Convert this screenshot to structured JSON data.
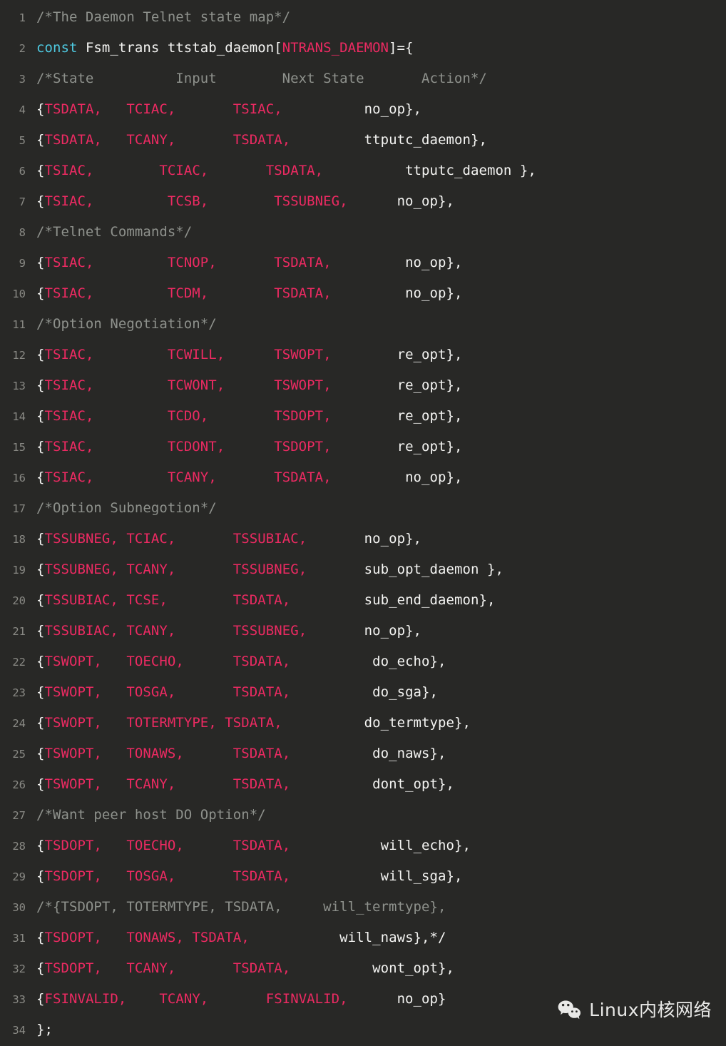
{
  "editor": {
    "background": "#282826",
    "line_number_color": "#8a8a85",
    "text_color": "#f2f2f2",
    "comment_color": "#8e918c",
    "constant_color": "#ec2a62",
    "keyword_color": "#4ec9e0",
    "language": "C",
    "first_line": 1,
    "last_line": 34
  },
  "watermark": {
    "logo": "wechat-icon",
    "label": "Linux内核网络"
  },
  "code": {
    "lines": [
      {
        "n": "1",
        "tokens": [
          {
            "t": "/*The Daemon Telnet state map*/",
            "c": "comment"
          }
        ]
      },
      {
        "n": "2",
        "tokens": [
          {
            "t": "const",
            "c": "kw"
          },
          {
            "t": " Fsm_trans ttstab_daemon[",
            "c": "plain"
          },
          {
            "t": "NTRANS_DAEMON",
            "c": "const"
          },
          {
            "t": "]={",
            "c": "plain"
          }
        ]
      },
      {
        "n": "3",
        "tokens": [
          {
            "t": "/*State          Input        Next State       Action*/",
            "c": "comment"
          }
        ]
      },
      {
        "n": "4",
        "tokens": [
          {
            "t": "{",
            "c": "plain"
          },
          {
            "t": "TSDATA,",
            "c": "const"
          },
          {
            "t": "   ",
            "c": "plain"
          },
          {
            "t": "TCIAC,",
            "c": "const"
          },
          {
            "t": "       ",
            "c": "plain"
          },
          {
            "t": "TSIAC,",
            "c": "const"
          },
          {
            "t": "          ",
            "c": "plain"
          },
          {
            "t": "no_op},",
            "c": "plain"
          }
        ]
      },
      {
        "n": "5",
        "tokens": [
          {
            "t": "{",
            "c": "plain"
          },
          {
            "t": "TSDATA,",
            "c": "const"
          },
          {
            "t": "   ",
            "c": "plain"
          },
          {
            "t": "TCANY,",
            "c": "const"
          },
          {
            "t": "       ",
            "c": "plain"
          },
          {
            "t": "TSDATA,",
            "c": "const"
          },
          {
            "t": "         ",
            "c": "plain"
          },
          {
            "t": "ttputc_daemon},",
            "c": "plain"
          }
        ]
      },
      {
        "n": "6",
        "tokens": [
          {
            "t": "{",
            "c": "plain"
          },
          {
            "t": "TSIAC,",
            "c": "const"
          },
          {
            "t": "        ",
            "c": "plain"
          },
          {
            "t": "TCIAC,",
            "c": "const"
          },
          {
            "t": "       ",
            "c": "plain"
          },
          {
            "t": "TSDATA,",
            "c": "const"
          },
          {
            "t": "          ",
            "c": "plain"
          },
          {
            "t": "ttputc_daemon },",
            "c": "plain"
          }
        ]
      },
      {
        "n": "7",
        "tokens": [
          {
            "t": "{",
            "c": "plain"
          },
          {
            "t": "TSIAC,",
            "c": "const"
          },
          {
            "t": "         ",
            "c": "plain"
          },
          {
            "t": "TCSB,",
            "c": "const"
          },
          {
            "t": "        ",
            "c": "plain"
          },
          {
            "t": "TSSUBNEG,",
            "c": "const"
          },
          {
            "t": "      ",
            "c": "plain"
          },
          {
            "t": "no_op},",
            "c": "plain"
          }
        ]
      },
      {
        "n": "8",
        "tokens": [
          {
            "t": "/*Telnet Commands*/",
            "c": "comment"
          }
        ]
      },
      {
        "n": "9",
        "tokens": [
          {
            "t": "{",
            "c": "plain"
          },
          {
            "t": "TSIAC,",
            "c": "const"
          },
          {
            "t": "         ",
            "c": "plain"
          },
          {
            "t": "TCNOP,",
            "c": "const"
          },
          {
            "t": "       ",
            "c": "plain"
          },
          {
            "t": "TSDATA,",
            "c": "const"
          },
          {
            "t": "         ",
            "c": "plain"
          },
          {
            "t": "no_op},",
            "c": "plain"
          }
        ]
      },
      {
        "n": "10",
        "tokens": [
          {
            "t": "{",
            "c": "plain"
          },
          {
            "t": "TSIAC,",
            "c": "const"
          },
          {
            "t": "         ",
            "c": "plain"
          },
          {
            "t": "TCDM,",
            "c": "const"
          },
          {
            "t": "        ",
            "c": "plain"
          },
          {
            "t": "TSDATA,",
            "c": "const"
          },
          {
            "t": "         ",
            "c": "plain"
          },
          {
            "t": "no_op},",
            "c": "plain"
          }
        ]
      },
      {
        "n": "11",
        "tokens": [
          {
            "t": "/*Option Negotiation*/",
            "c": "comment"
          }
        ]
      },
      {
        "n": "12",
        "tokens": [
          {
            "t": "{",
            "c": "plain"
          },
          {
            "t": "TSIAC,",
            "c": "const"
          },
          {
            "t": "         ",
            "c": "plain"
          },
          {
            "t": "TCWILL,",
            "c": "const"
          },
          {
            "t": "      ",
            "c": "plain"
          },
          {
            "t": "TSWOPT,",
            "c": "const"
          },
          {
            "t": "        ",
            "c": "plain"
          },
          {
            "t": "re_opt},",
            "c": "plain"
          }
        ]
      },
      {
        "n": "13",
        "tokens": [
          {
            "t": "{",
            "c": "plain"
          },
          {
            "t": "TSIAC,",
            "c": "const"
          },
          {
            "t": "         ",
            "c": "plain"
          },
          {
            "t": "TCWONT,",
            "c": "const"
          },
          {
            "t": "      ",
            "c": "plain"
          },
          {
            "t": "TSWOPT,",
            "c": "const"
          },
          {
            "t": "        ",
            "c": "plain"
          },
          {
            "t": "re_opt},",
            "c": "plain"
          }
        ]
      },
      {
        "n": "14",
        "tokens": [
          {
            "t": "{",
            "c": "plain"
          },
          {
            "t": "TSIAC,",
            "c": "const"
          },
          {
            "t": "         ",
            "c": "plain"
          },
          {
            "t": "TCDO,",
            "c": "const"
          },
          {
            "t": "        ",
            "c": "plain"
          },
          {
            "t": "TSDOPT,",
            "c": "const"
          },
          {
            "t": "        ",
            "c": "plain"
          },
          {
            "t": "re_opt},",
            "c": "plain"
          }
        ]
      },
      {
        "n": "15",
        "tokens": [
          {
            "t": "{",
            "c": "plain"
          },
          {
            "t": "TSIAC,",
            "c": "const"
          },
          {
            "t": "         ",
            "c": "plain"
          },
          {
            "t": "TCDONT,",
            "c": "const"
          },
          {
            "t": "      ",
            "c": "plain"
          },
          {
            "t": "TSDOPT,",
            "c": "const"
          },
          {
            "t": "        ",
            "c": "plain"
          },
          {
            "t": "re_opt},",
            "c": "plain"
          }
        ]
      },
      {
        "n": "16",
        "tokens": [
          {
            "t": "{",
            "c": "plain"
          },
          {
            "t": "TSIAC,",
            "c": "const"
          },
          {
            "t": "         ",
            "c": "plain"
          },
          {
            "t": "TCANY,",
            "c": "const"
          },
          {
            "t": "       ",
            "c": "plain"
          },
          {
            "t": "TSDATA,",
            "c": "const"
          },
          {
            "t": "         ",
            "c": "plain"
          },
          {
            "t": "no_op},",
            "c": "plain"
          }
        ]
      },
      {
        "n": "17",
        "tokens": [
          {
            "t": "/*Option Subnegotion*/",
            "c": "comment"
          }
        ]
      },
      {
        "n": "18",
        "tokens": [
          {
            "t": "{",
            "c": "plain"
          },
          {
            "t": "TSSUBNEG,",
            "c": "const"
          },
          {
            "t": " ",
            "c": "plain"
          },
          {
            "t": "TCIAC,",
            "c": "const"
          },
          {
            "t": "       ",
            "c": "plain"
          },
          {
            "t": "TSSUBIAC,",
            "c": "const"
          },
          {
            "t": "       ",
            "c": "plain"
          },
          {
            "t": "no_op},",
            "c": "plain"
          }
        ]
      },
      {
        "n": "19",
        "tokens": [
          {
            "t": "{",
            "c": "plain"
          },
          {
            "t": "TSSUBNEG,",
            "c": "const"
          },
          {
            "t": " ",
            "c": "plain"
          },
          {
            "t": "TCANY,",
            "c": "const"
          },
          {
            "t": "       ",
            "c": "plain"
          },
          {
            "t": "TSSUBNEG,",
            "c": "const"
          },
          {
            "t": "       ",
            "c": "plain"
          },
          {
            "t": "sub_opt_daemon },",
            "c": "plain"
          }
        ]
      },
      {
        "n": "20",
        "tokens": [
          {
            "t": "{",
            "c": "plain"
          },
          {
            "t": "TSSUBIAC,",
            "c": "const"
          },
          {
            "t": " ",
            "c": "plain"
          },
          {
            "t": "TCSE,",
            "c": "const"
          },
          {
            "t": "        ",
            "c": "plain"
          },
          {
            "t": "TSDATA,",
            "c": "const"
          },
          {
            "t": "         ",
            "c": "plain"
          },
          {
            "t": "sub_end_daemon},",
            "c": "plain"
          }
        ]
      },
      {
        "n": "21",
        "tokens": [
          {
            "t": "{",
            "c": "plain"
          },
          {
            "t": "TSSUBIAC,",
            "c": "const"
          },
          {
            "t": " ",
            "c": "plain"
          },
          {
            "t": "TCANY,",
            "c": "const"
          },
          {
            "t": "       ",
            "c": "plain"
          },
          {
            "t": "TSSUBNEG,",
            "c": "const"
          },
          {
            "t": "       ",
            "c": "plain"
          },
          {
            "t": "no_op},",
            "c": "plain"
          }
        ]
      },
      {
        "n": "22",
        "tokens": [
          {
            "t": "{",
            "c": "plain"
          },
          {
            "t": "TSWOPT,",
            "c": "const"
          },
          {
            "t": "   ",
            "c": "plain"
          },
          {
            "t": "TOECHO,",
            "c": "const"
          },
          {
            "t": "      ",
            "c": "plain"
          },
          {
            "t": "TSDATA,",
            "c": "const"
          },
          {
            "t": "          ",
            "c": "plain"
          },
          {
            "t": "do_echo},",
            "c": "plain"
          }
        ]
      },
      {
        "n": "23",
        "tokens": [
          {
            "t": "{",
            "c": "plain"
          },
          {
            "t": "TSWOPT,",
            "c": "const"
          },
          {
            "t": "   ",
            "c": "plain"
          },
          {
            "t": "TOSGA,",
            "c": "const"
          },
          {
            "t": "       ",
            "c": "plain"
          },
          {
            "t": "TSDATA,",
            "c": "const"
          },
          {
            "t": "          ",
            "c": "plain"
          },
          {
            "t": "do_sga},",
            "c": "plain"
          }
        ]
      },
      {
        "n": "24",
        "tokens": [
          {
            "t": "{",
            "c": "plain"
          },
          {
            "t": "TSWOPT,",
            "c": "const"
          },
          {
            "t": "   ",
            "c": "plain"
          },
          {
            "t": "TOTERMTYPE,",
            "c": "const"
          },
          {
            "t": " ",
            "c": "plain"
          },
          {
            "t": "TSDATA,",
            "c": "const"
          },
          {
            "t": "          ",
            "c": "plain"
          },
          {
            "t": "do_termtype},",
            "c": "plain"
          }
        ]
      },
      {
        "n": "25",
        "tokens": [
          {
            "t": "{",
            "c": "plain"
          },
          {
            "t": "TSWOPT,",
            "c": "const"
          },
          {
            "t": "   ",
            "c": "plain"
          },
          {
            "t": "TONAWS,",
            "c": "const"
          },
          {
            "t": "      ",
            "c": "plain"
          },
          {
            "t": "TSDATA,",
            "c": "const"
          },
          {
            "t": "          ",
            "c": "plain"
          },
          {
            "t": "do_naws},",
            "c": "plain"
          }
        ]
      },
      {
        "n": "26",
        "tokens": [
          {
            "t": "{",
            "c": "plain"
          },
          {
            "t": "TSWOPT,",
            "c": "const"
          },
          {
            "t": "   ",
            "c": "plain"
          },
          {
            "t": "TCANY,",
            "c": "const"
          },
          {
            "t": "       ",
            "c": "plain"
          },
          {
            "t": "TSDATA,",
            "c": "const"
          },
          {
            "t": "          ",
            "c": "plain"
          },
          {
            "t": "dont_opt},",
            "c": "plain"
          }
        ]
      },
      {
        "n": "27",
        "tokens": [
          {
            "t": "/*Want peer host DO Option*/",
            "c": "comment"
          }
        ]
      },
      {
        "n": "28",
        "tokens": [
          {
            "t": "{",
            "c": "plain"
          },
          {
            "t": "TSDOPT,",
            "c": "const"
          },
          {
            "t": "   ",
            "c": "plain"
          },
          {
            "t": "TOECHO,",
            "c": "const"
          },
          {
            "t": "      ",
            "c": "plain"
          },
          {
            "t": "TSDATA,",
            "c": "const"
          },
          {
            "t": "           ",
            "c": "plain"
          },
          {
            "t": "will_echo},",
            "c": "plain"
          }
        ]
      },
      {
        "n": "29",
        "tokens": [
          {
            "t": "{",
            "c": "plain"
          },
          {
            "t": "TSDOPT,",
            "c": "const"
          },
          {
            "t": "   ",
            "c": "plain"
          },
          {
            "t": "TOSGA,",
            "c": "const"
          },
          {
            "t": "       ",
            "c": "plain"
          },
          {
            "t": "TSDATA,",
            "c": "const"
          },
          {
            "t": "           ",
            "c": "plain"
          },
          {
            "t": "will_sga},",
            "c": "plain"
          }
        ]
      },
      {
        "n": "30",
        "tokens": [
          {
            "t": "/*{TSDOPT, TOTERMTYPE, TSDATA,     will_termtype},",
            "c": "comment"
          }
        ]
      },
      {
        "n": "31",
        "tokens": [
          {
            "t": "{",
            "c": "plain"
          },
          {
            "t": "TSDOPT,",
            "c": "const"
          },
          {
            "t": "   ",
            "c": "plain"
          },
          {
            "t": "TONAWS,",
            "c": "const"
          },
          {
            "t": " ",
            "c": "plain"
          },
          {
            "t": "TSDATA,",
            "c": "const"
          },
          {
            "t": "           ",
            "c": "plain"
          },
          {
            "t": "will_naws},*/",
            "c": "plain"
          }
        ]
      },
      {
        "n": "32",
        "tokens": [
          {
            "t": "{",
            "c": "plain"
          },
          {
            "t": "TSDOPT,",
            "c": "const"
          },
          {
            "t": "   ",
            "c": "plain"
          },
          {
            "t": "TCANY,",
            "c": "const"
          },
          {
            "t": "       ",
            "c": "plain"
          },
          {
            "t": "TSDATA,",
            "c": "const"
          },
          {
            "t": "          ",
            "c": "plain"
          },
          {
            "t": "wont_opt},",
            "c": "plain"
          }
        ]
      },
      {
        "n": "33",
        "tokens": [
          {
            "t": "{",
            "c": "plain"
          },
          {
            "t": "FSINVALID,",
            "c": "const"
          },
          {
            "t": "    ",
            "c": "plain"
          },
          {
            "t": "TCANY,",
            "c": "const"
          },
          {
            "t": "       ",
            "c": "plain"
          },
          {
            "t": "FSINVALID,",
            "c": "const"
          },
          {
            "t": "      ",
            "c": "plain"
          },
          {
            "t": "no_op}",
            "c": "plain"
          }
        ]
      },
      {
        "n": "34",
        "tokens": [
          {
            "t": "};",
            "c": "plain"
          }
        ]
      }
    ]
  }
}
